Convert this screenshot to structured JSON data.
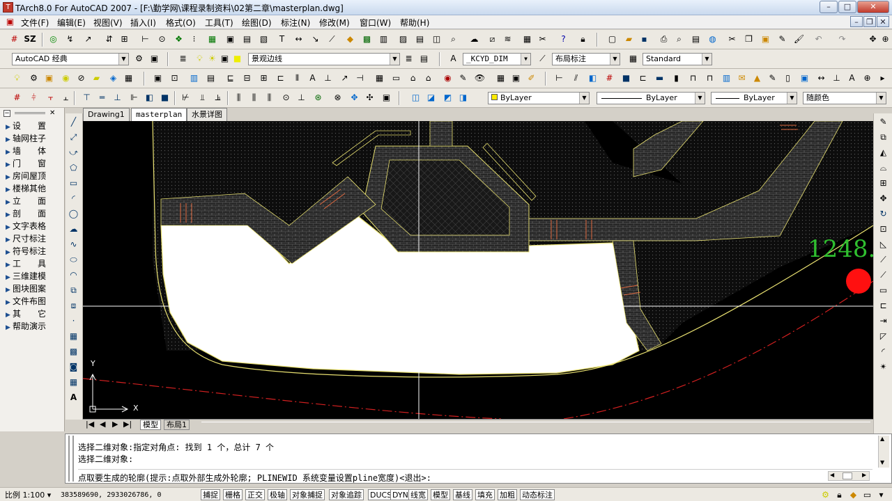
{
  "window": {
    "title": "TArch8.0 For AutoCAD 2007 - [F:\\勤学网\\课程录制资料\\02第二章\\masterplan.dwg]",
    "min": "–",
    "max": "□",
    "close": "✕"
  },
  "menu": [
    "文件(F)",
    "编辑(E)",
    "视图(V)",
    "插入(I)",
    "格式(O)",
    "工具(T)",
    "绘图(D)",
    "标注(N)",
    "修改(M)",
    "窗口(W)",
    "帮助(H)"
  ],
  "toolbar": {
    "sz_label": "SZ",
    "workspace": "AutoCAD 经典",
    "layer": "景观边线",
    "dimstyle": "_KCYD_DIM",
    "dim_layer": "布局标注",
    "textstyle": "Standard",
    "color": "ByLayer",
    "linetype": "ByLayer",
    "lineweight": "ByLayer",
    "plotstyle": "随颜色"
  },
  "tabs": [
    "Drawing1",
    "masterplan",
    "水景详图"
  ],
  "left_panel": [
    "设　　置",
    "轴网柱子",
    "墙　　体",
    "门　　窗",
    "房间屋顶",
    "楼梯其他",
    "立　　面",
    "剖　　面",
    "文字表格",
    "尺寸标注",
    "符号标注",
    "工　　具",
    "三维建模",
    "图块图案",
    "文件布图",
    "其　　它",
    "帮助演示"
  ],
  "canvas": {
    "dim_text": "1248.",
    "ucs_x": "X",
    "ucs_y": "Y"
  },
  "layout_tabs": [
    "模型",
    "布局1"
  ],
  "command": {
    "lines": [
      "选择二维对象:指定对角点: 找到 1 个，总计 7 个",
      "选择二维对象:",
      "点取要生成的轮廓(提示:点取外部生成外轮廓; PLINEWID 系统变量设置pline宽度)<退出>:"
    ]
  },
  "status": {
    "scale": "比例 1:100 ▾",
    "coords": "383589690, 2933026786, 0",
    "toggles": [
      "捕捉",
      "栅格",
      "正交",
      "极轴",
      "对象捕捉",
      "对象追踪",
      "DUCS",
      "DYN",
      "线宽",
      "模型",
      "基线",
      "填充",
      "加粗",
      "动态标注"
    ]
  },
  "colors": {
    "canvas": "#000000",
    "hatch": "#5a5a5a",
    "boundary": "#e8e070",
    "red_line": "#d42020",
    "dim_text": "#2fbf2f"
  }
}
